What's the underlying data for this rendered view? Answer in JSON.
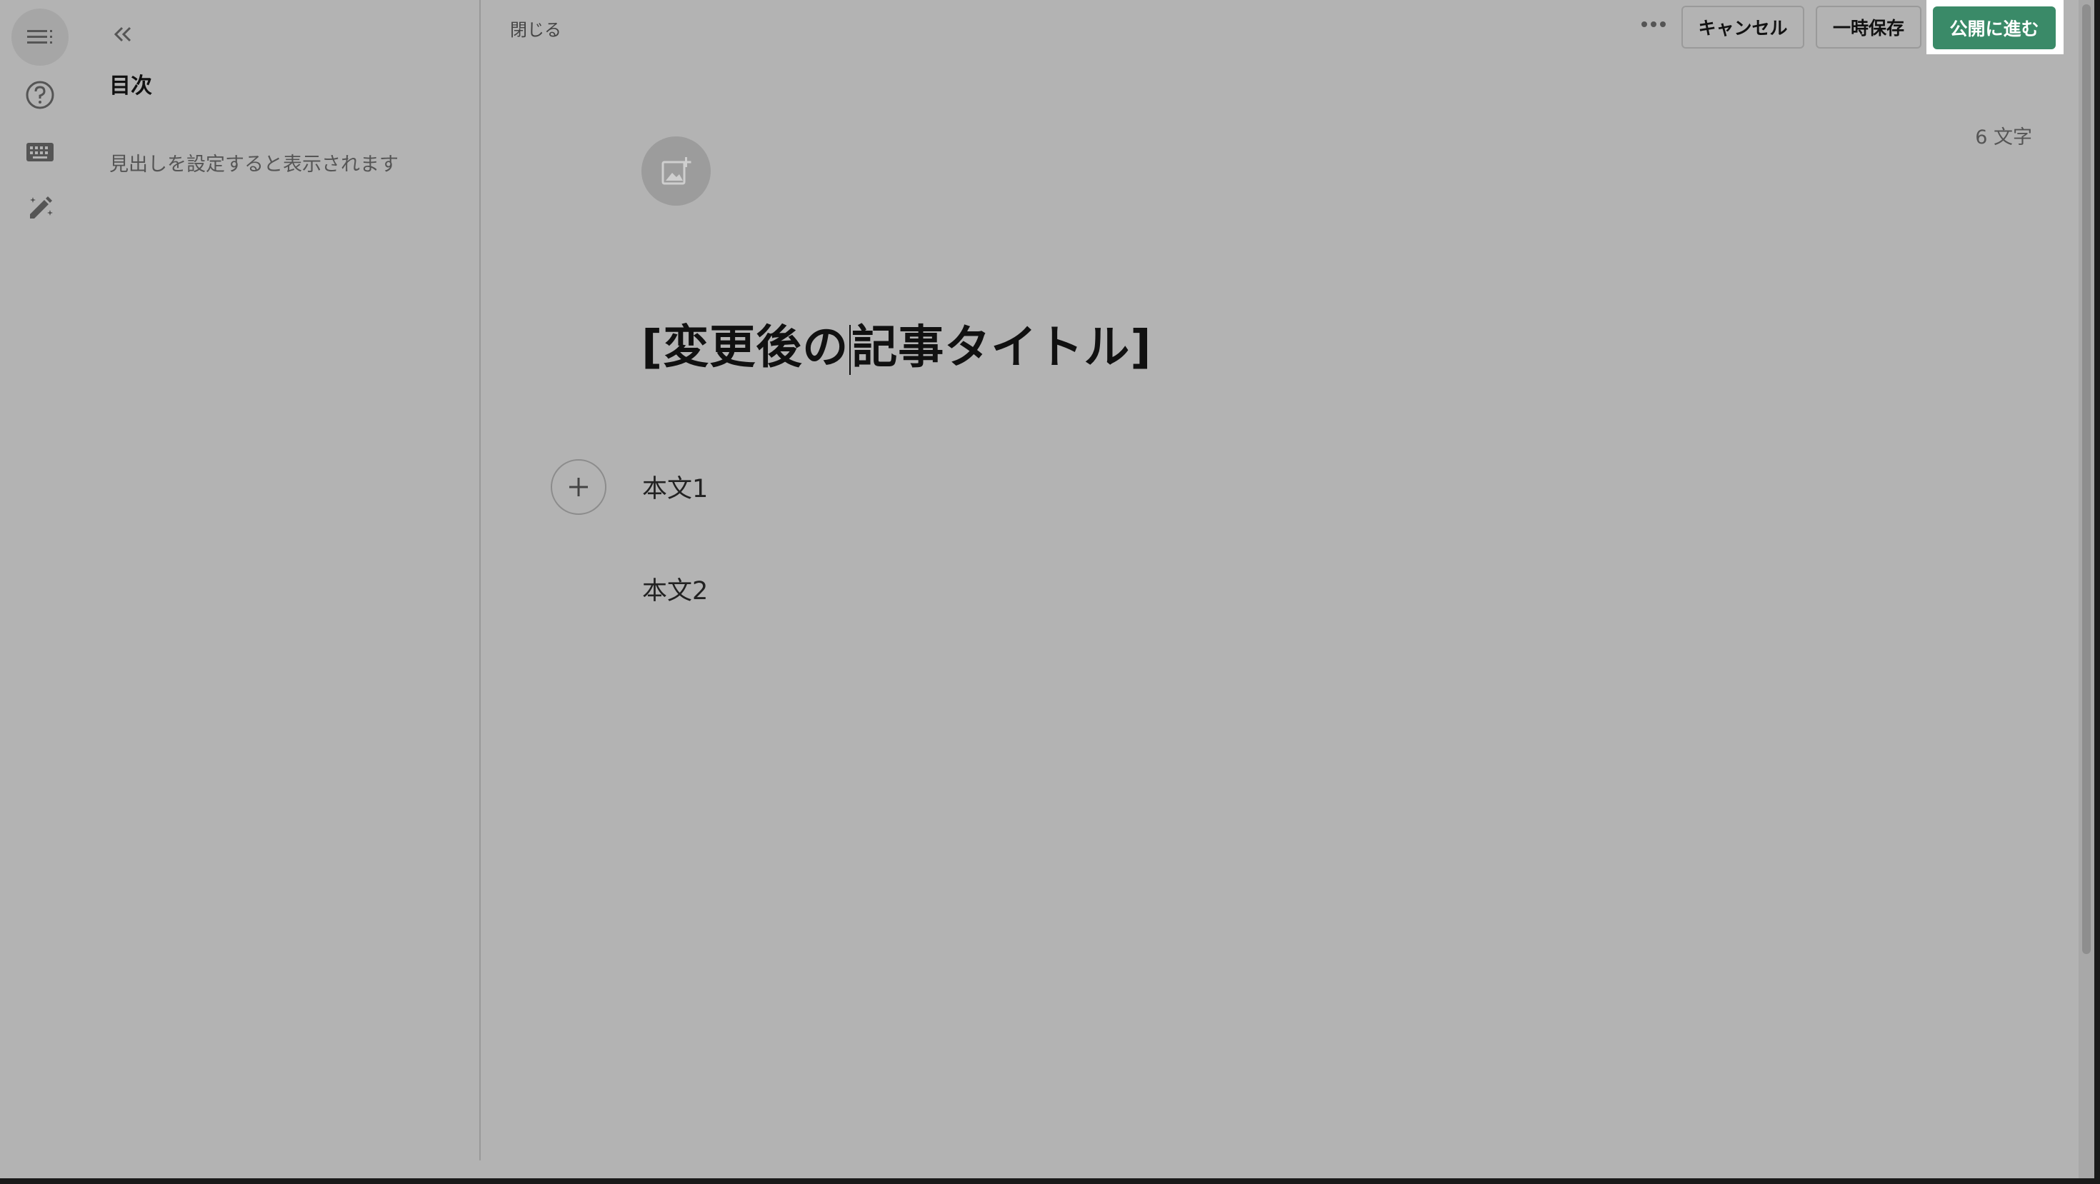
{
  "sidebar": {
    "icons": [
      {
        "name": "toc-list-icon",
        "active": true
      },
      {
        "name": "help-icon",
        "active": false
      },
      {
        "name": "keyboard-icon",
        "active": false
      },
      {
        "name": "magic-pen-icon",
        "active": false
      }
    ]
  },
  "toc": {
    "title": "目次",
    "empty_message": "見出しを設定すると表示されます"
  },
  "toolbar": {
    "close_label": "閉じる",
    "cancel_label": "キャンセル",
    "draft_save_label": "一時保存",
    "publish_label": "公開に進む"
  },
  "editor": {
    "char_count": "6 文字",
    "title_before_caret": "[変更後の",
    "title_after_caret": "記事タイトル]",
    "paragraphs": [
      "本文1",
      "本文2"
    ]
  },
  "colors": {
    "overlay_background": "#b3b3b3",
    "publish_button": "#3a8a68",
    "publish_highlight": "#ffffff"
  }
}
